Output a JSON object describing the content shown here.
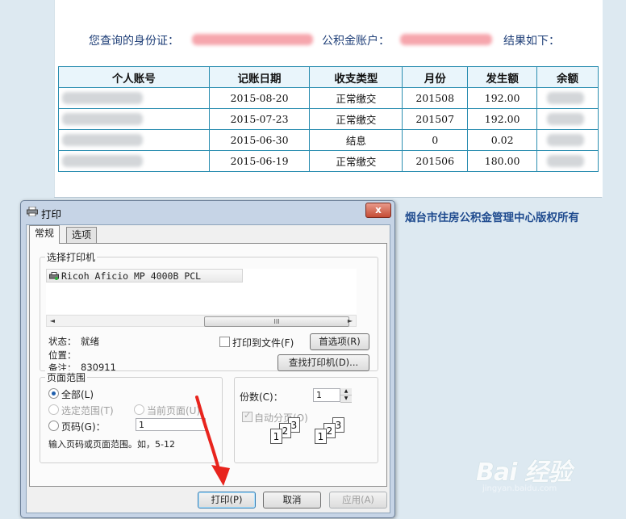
{
  "header": {
    "id_prefix": "您查询的身份证：",
    "account_prefix": "公积金账户：",
    "result_suffix": "结果如下："
  },
  "table": {
    "columns": [
      "个人账号",
      "记账日期",
      "收支类型",
      "月份",
      "发生额",
      "余额"
    ],
    "rows": [
      {
        "date": "2015-08-20",
        "type": "正常缴交",
        "month": "201508",
        "amount": "192.00"
      },
      {
        "date": "2015-07-23",
        "type": "正常缴交",
        "month": "201507",
        "amount": "192.00"
      },
      {
        "date": "2015-06-30",
        "type": "结息",
        "month": "0",
        "amount": "0.02"
      },
      {
        "date": "2015-06-19",
        "type": "正常缴交",
        "month": "201506",
        "amount": "180.00"
      }
    ]
  },
  "footer": {
    "copyright": "烟台市住房公积金管理中心版权所有"
  },
  "dialog": {
    "title": "打印",
    "close_label": "x",
    "tabs": [
      "常规",
      "选项"
    ],
    "printer_group": {
      "title": "选择打印机",
      "selected_printer": "Ricoh Aficio MP 4000B PCL",
      "scroll_left": "◄",
      "scroll_right": "►",
      "scroll_grip": "III",
      "status_label": "状态：",
      "status_value": "就绪",
      "location_label": "位置：",
      "location_value": "",
      "comment_label": "备注：",
      "comment_value": "830911",
      "print_to_file_label": "打印到文件(F)",
      "preferences_button": "首选项(R)",
      "find_printer_button": "查找打印机(D)..."
    },
    "range_group": {
      "title": "页面范围",
      "all_label": "全部(L)",
      "selection_label": "选定范围(T)",
      "current_page_label": "当前页面(U)",
      "pages_label": "页码(G)：",
      "pages_value": "1",
      "hint": "输入页码或页面范围。如，5-12"
    },
    "copies_group": {
      "copies_label": "份数(C)：",
      "copies_value": "1",
      "spin_up": "▲",
      "spin_down": "▼",
      "collate_label": "自动分页(O)",
      "collate_checked": true,
      "collate_pages": [
        "1",
        "2",
        "3"
      ]
    },
    "buttons": {
      "print": "打印(P)",
      "cancel": "取消",
      "apply": "应用(A)"
    }
  },
  "watermark": {
    "logo": "Bai 经验",
    "url": "jingyan.baidu.com"
  },
  "colors": {
    "table_border": "#2a8db0",
    "header_text": "#1f3f78",
    "copyright_text": "#1f4b8f",
    "annotation_arrow": "#e8241d"
  }
}
